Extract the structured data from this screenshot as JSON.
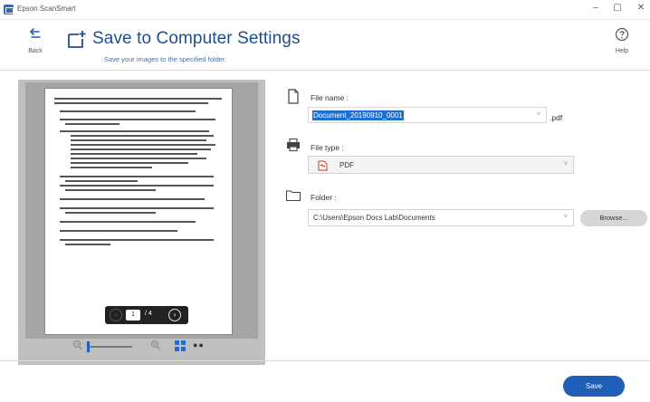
{
  "app": {
    "title": "Epson ScanSmart",
    "minimize_glyph": "–",
    "maximize_glyph": "▢",
    "close_glyph": "✕"
  },
  "header": {
    "back_label": "Back",
    "title": "Save to Computer Settings",
    "subtitle": "Save your images to the specified folder.",
    "help_label": "Help"
  },
  "preview": {
    "current_page": "1",
    "total_pages": "/ 4",
    "prev_glyph": "‹",
    "next_glyph": "›"
  },
  "form": {
    "file_name": {
      "label": "File name :",
      "value": "Document_20190910_0001",
      "extension": ".pdf",
      "icon": "document-icon"
    },
    "file_type": {
      "label": "File type :",
      "value": "PDF",
      "icon": "printer-icon"
    },
    "folder": {
      "label": "Folder :",
      "value": "C:\\Users\\Epson Docs Lab\\Documents",
      "icon": "folder-icon",
      "browse_label": "Browse..."
    }
  },
  "footer": {
    "save_label": "Save"
  },
  "colors": {
    "accent": "#1f5fb8",
    "title": "#1f4e8c",
    "selection": "#1f6fd1"
  }
}
